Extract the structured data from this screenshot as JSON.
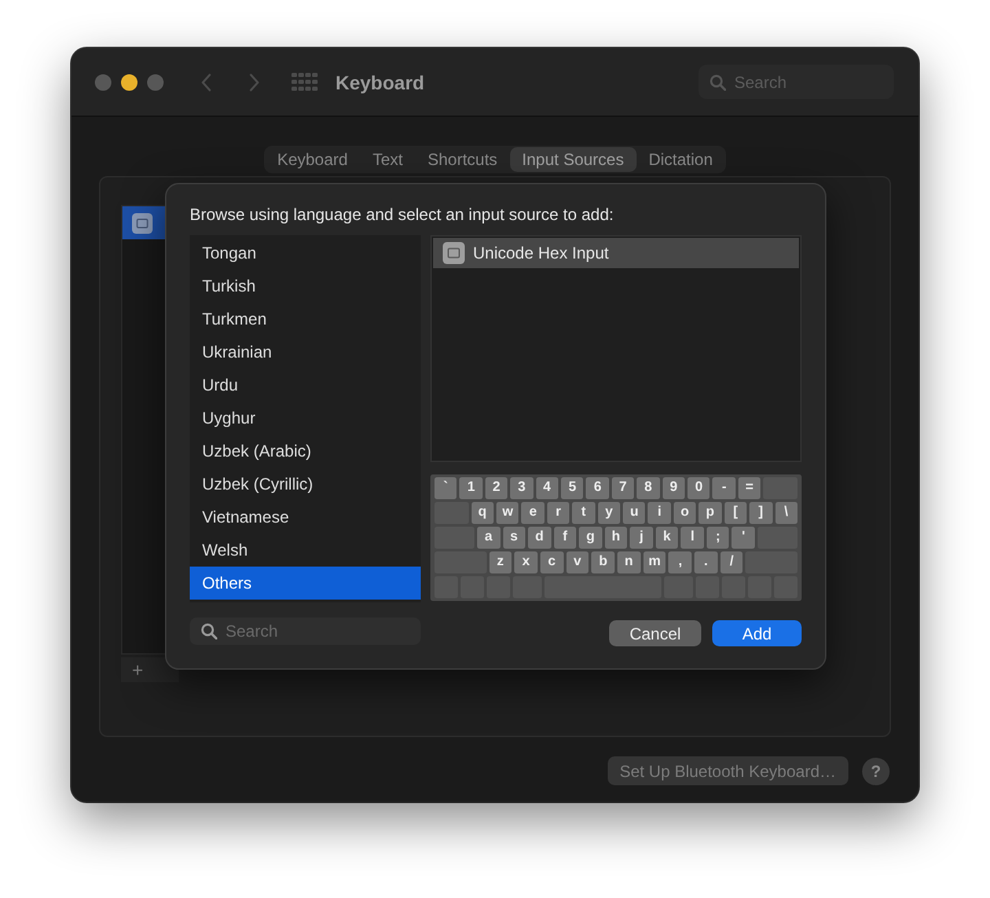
{
  "window": {
    "title": "Keyboard",
    "controls": [
      {
        "kind": "close",
        "enabled": false
      },
      {
        "kind": "minimize",
        "enabled": true
      },
      {
        "kind": "zoom",
        "enabled": false
      }
    ]
  },
  "search": {
    "placeholder": "Search"
  },
  "tabs": [
    {
      "label": "Keyboard",
      "selected": false
    },
    {
      "label": "Text",
      "selected": false
    },
    {
      "label": "Shortcuts",
      "selected": false
    },
    {
      "label": "Input Sources",
      "selected": true
    },
    {
      "label": "Dictation",
      "selected": false
    }
  ],
  "input_sources": {
    "items": [
      {
        "selected": true
      }
    ],
    "buttons": [
      "+"
    ]
  },
  "sheet": {
    "prompt": "Browse using language and select an input source to add:",
    "languages": [
      {
        "label": "Tongan",
        "selected": false
      },
      {
        "label": "Turkish",
        "selected": false
      },
      {
        "label": "Turkmen",
        "selected": false
      },
      {
        "label": "Ukrainian",
        "selected": false
      },
      {
        "label": "Urdu",
        "selected": false
      },
      {
        "label": "Uyghur",
        "selected": false
      },
      {
        "label": "Uzbek (Arabic)",
        "selected": false
      },
      {
        "label": "Uzbek (Cyrillic)",
        "selected": false
      },
      {
        "label": "Vietnamese",
        "selected": false
      },
      {
        "label": "Welsh",
        "selected": false
      },
      {
        "label": "Others",
        "selected": true
      }
    ],
    "search": {
      "placeholder": "Search"
    },
    "sources": [
      {
        "label": "Unicode Hex Input",
        "selected": true
      }
    ],
    "keyboard": {
      "rows": [
        [
          "`",
          "1",
          "2",
          "3",
          "4",
          "5",
          "6",
          "7",
          "8",
          "9",
          "0",
          "-",
          "="
        ],
        [
          "q",
          "w",
          "e",
          "r",
          "t",
          "y",
          "u",
          "i",
          "o",
          "p",
          "[",
          "]",
          "\\"
        ],
        [
          "a",
          "s",
          "d",
          "f",
          "g",
          "h",
          "j",
          "k",
          "l",
          ";",
          "'"
        ],
        [
          "z",
          "x",
          "c",
          "v",
          "b",
          "n",
          "m",
          ",",
          ".",
          "/"
        ]
      ]
    },
    "buttons": [
      {
        "label": "Cancel",
        "kind": "cancel"
      },
      {
        "label": "Add",
        "kind": "default"
      }
    ]
  },
  "footer": {
    "bluetooth_button": "Set Up Bluetooth Keyboard…",
    "help_button": "?"
  }
}
